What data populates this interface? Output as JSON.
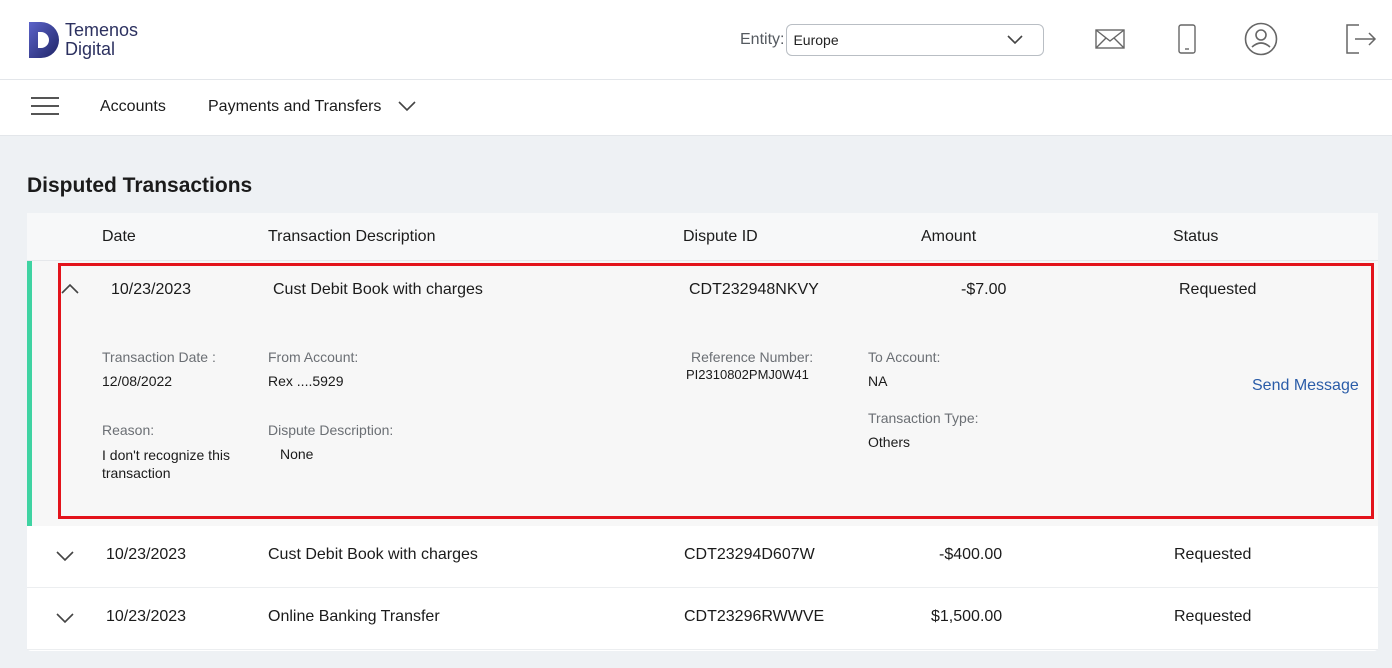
{
  "brand": {
    "line1": "Temenos",
    "line2": "Digital"
  },
  "entity": {
    "label": "Entity:",
    "value": "Europe"
  },
  "header_icons": [
    "mail-icon",
    "mobile-icon",
    "user-profile-icon",
    "logout-icon"
  ],
  "nav": {
    "accounts": "Accounts",
    "payments": "Payments and Transfers"
  },
  "page": {
    "title": "Disputed Transactions"
  },
  "columns": {
    "date": "Date",
    "description": "Transaction Description",
    "dispute_id": "Dispute ID",
    "amount": "Amount",
    "status": "Status"
  },
  "expanded_row": {
    "date": "10/23/2023",
    "description": "Cust Debit Book with charges",
    "dispute_id": "CDT232948NKVY",
    "amount": "-$7.00",
    "status": "Requested",
    "details": {
      "transaction_date_label": "Transaction Date :",
      "transaction_date": "12/08/2022",
      "from_account_label": "From Account:",
      "from_account": "Rex ....5929",
      "reference_label": "Reference Number:",
      "reference": "PI2310802PMJ0W41",
      "to_account_label": "To Account:",
      "to_account": "NA",
      "reason_label": "Reason:",
      "reason": "I don't recognize this transaction",
      "dispute_desc_label": "Dispute Description:",
      "dispute_desc": "None",
      "txn_type_label": "Transaction Type:",
      "txn_type": "Others",
      "send_message": "Send Message"
    }
  },
  "rows": [
    {
      "date": "10/23/2023",
      "description": "Cust Debit Book with charges",
      "dispute_id": "CDT23294D607W",
      "amount": "-$400.00",
      "status": "Requested"
    },
    {
      "date": "10/23/2023",
      "description": "Online Banking Transfer",
      "dispute_id": "CDT23296RWWVE",
      "amount": "$1,500.00",
      "status": "Requested"
    }
  ],
  "colors": {
    "accent": "#3fd3a2",
    "highlight": "#e3131b",
    "link": "#2a5ca8",
    "brand": "#2c3160"
  }
}
